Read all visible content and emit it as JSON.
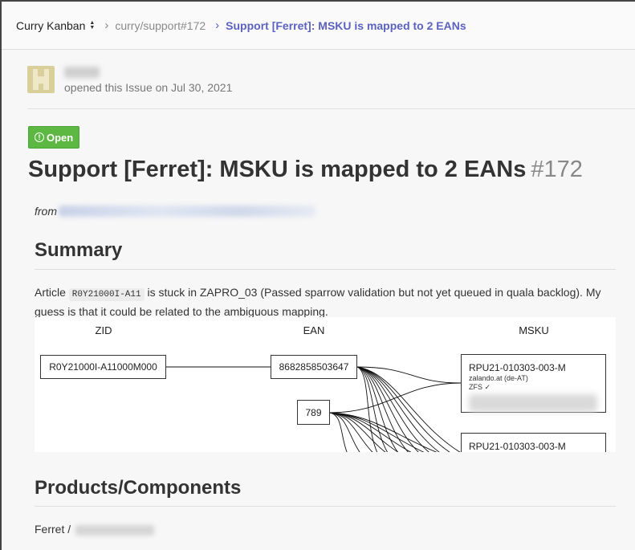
{
  "breadcrumb": {
    "project": "Curry Kanban",
    "issue_ref": "curry/support#172",
    "current": "Support [Ferret]: MSKU is mapped to 2 EANs"
  },
  "author": {
    "opened_text": "opened this Issue on Jul 30, 2021"
  },
  "issue": {
    "status": "Open",
    "title": "Support [Ferret]: MSKU is mapped to 2 EANs",
    "number": "#172",
    "from_label": "from"
  },
  "summary": {
    "heading": "Summary",
    "text_before": "Article ",
    "article_code": "R0Y21000I-A11",
    "text_after": " is stuck in ZAPRO_03 (Passed sparrow validation but not yet queued in quala backlog). My guess is that it could be related to the ambiguous mapping."
  },
  "diagram": {
    "columns": [
      "ZID",
      "EAN",
      "MSKU"
    ],
    "zid": "R0Y21000I-A11000M000",
    "ean1": "8682858503647",
    "ean2": "789",
    "msku1_title": "RPU21-010303-003-M",
    "msku1_market": "zalando.at (de-AT)",
    "msku1_tag": "ZFS ✓",
    "msku2_title": "RPU21-010303-003-M"
  },
  "products": {
    "heading": "Products/Components",
    "value": "Ferret /"
  },
  "colors": {
    "accent": "#5b62c0",
    "status_open": "#5cb843"
  }
}
